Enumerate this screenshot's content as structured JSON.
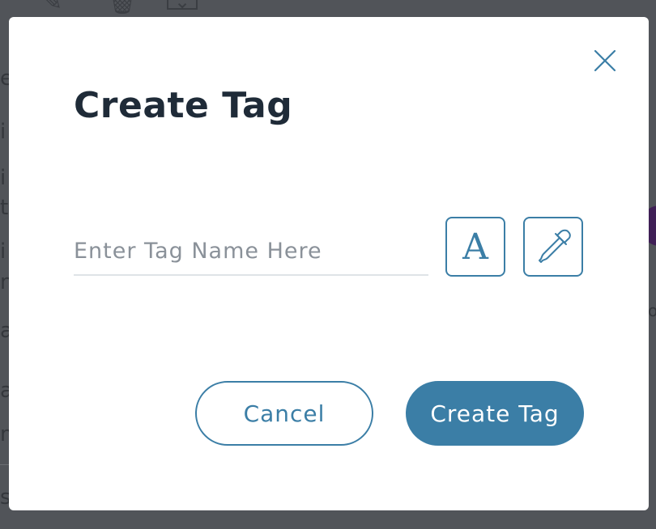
{
  "dialog": {
    "title": "Create Tag",
    "tag_name_input": {
      "value": "",
      "placeholder": "Enter Tag Name Here"
    },
    "font_button_glyph": "A",
    "cancel_label": "Cancel",
    "create_label": "Create Tag"
  },
  "icons": {
    "close": "close-icon",
    "font": "font-icon",
    "color_picker": "eyedropper-icon"
  },
  "colors": {
    "accent": "#3b7ea6",
    "title": "#1f2b38",
    "backdrop": "#515459"
  }
}
